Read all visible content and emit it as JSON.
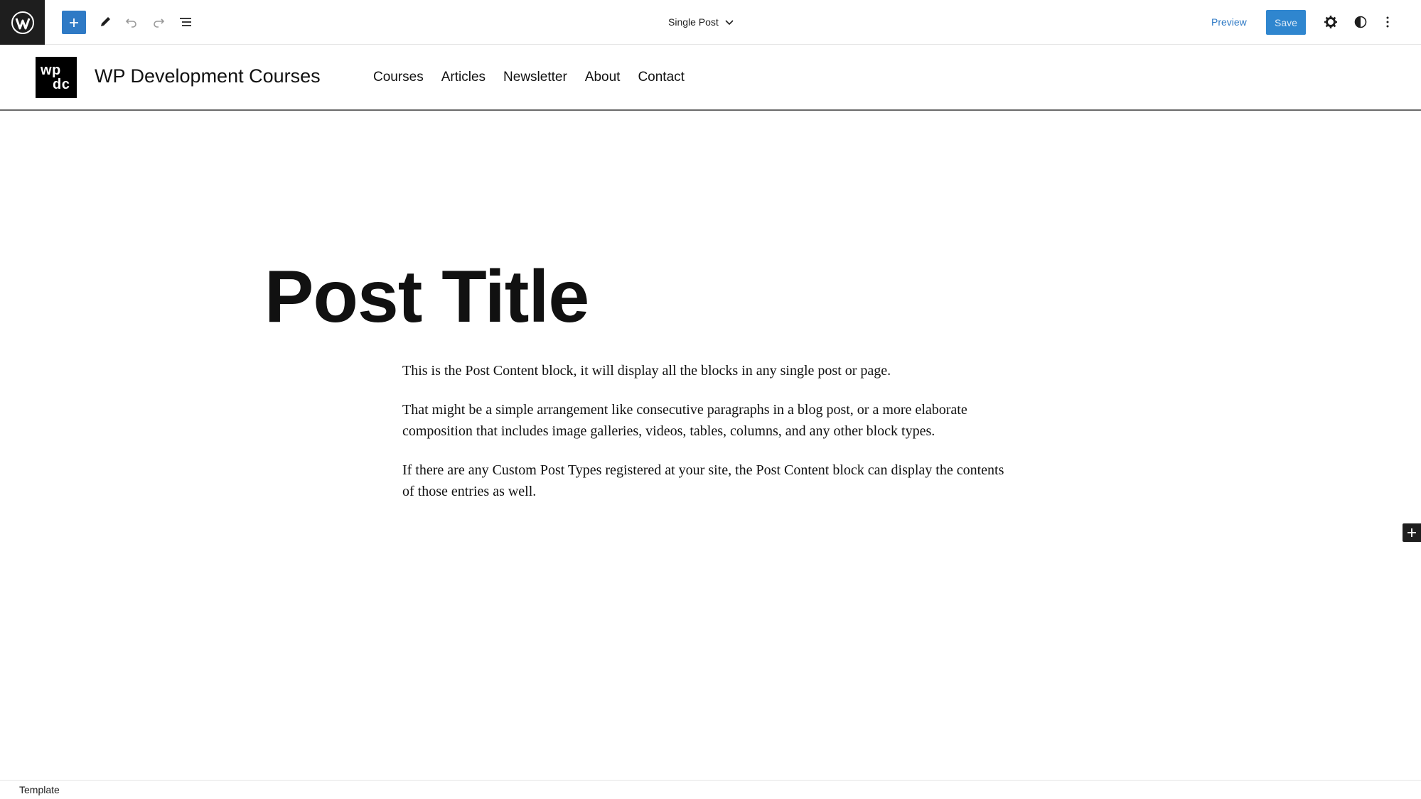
{
  "toolbar": {
    "document_title": "Single Post",
    "preview_label": "Preview",
    "save_label": "Save"
  },
  "site": {
    "logo_line1": "wp",
    "logo_line2": "dc",
    "title": "WP Development Courses",
    "nav": [
      "Courses",
      "Articles",
      "Newsletter",
      "About",
      "Contact"
    ]
  },
  "post": {
    "title": "Post Title",
    "paragraphs": [
      "This is the Post Content block, it will display all the blocks in any single post or page.",
      "That might be a simple arrangement like consecutive paragraphs in a blog post, or a more elaborate composition that includes image galleries, videos, tables, columns, and any other block types.",
      "If there are any Custom Post Types registered at your site, the Post Content block can display the contents of those entries as well."
    ]
  },
  "footer": {
    "breadcrumb": "Template"
  },
  "colors": {
    "accent": "#2f7ac5",
    "dark": "#1e1e1e"
  }
}
